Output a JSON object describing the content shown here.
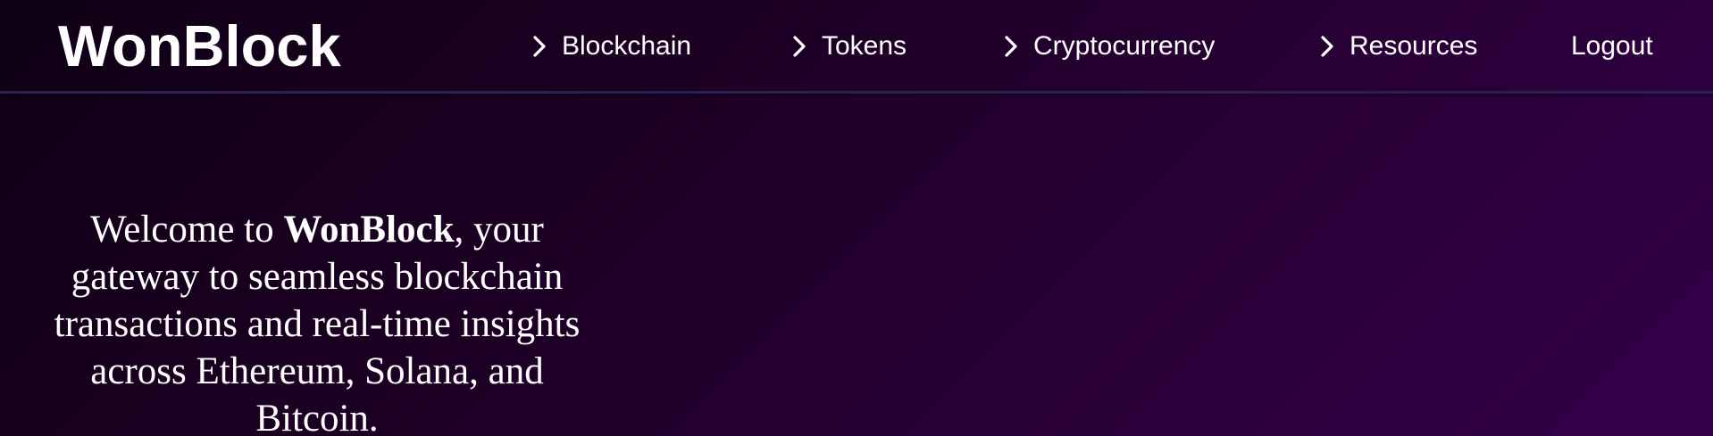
{
  "brand": {
    "name": "WonBlock"
  },
  "nav": {
    "items": [
      {
        "label": "Blockchain",
        "icon": "chevron-right-icon"
      },
      {
        "label": "Tokens",
        "icon": "chevron-right-icon"
      },
      {
        "label": "Cryptocurrency",
        "icon": "chevron-right-icon"
      },
      {
        "label": "Resources",
        "icon": "chevron-right-icon"
      }
    ],
    "logout_label": "Logout"
  },
  "hero": {
    "prefix": "Welcome to ",
    "brand": "WonBlock",
    "suffix": ", your gateway to seamless blockchain transactions and real-time insights across Ethereum, Solana, and Bitcoin."
  },
  "colors": {
    "background_start": "#0f0015",
    "background_end": "#33004a",
    "navbar_border": "#2d2154",
    "text": "#ffffff"
  }
}
